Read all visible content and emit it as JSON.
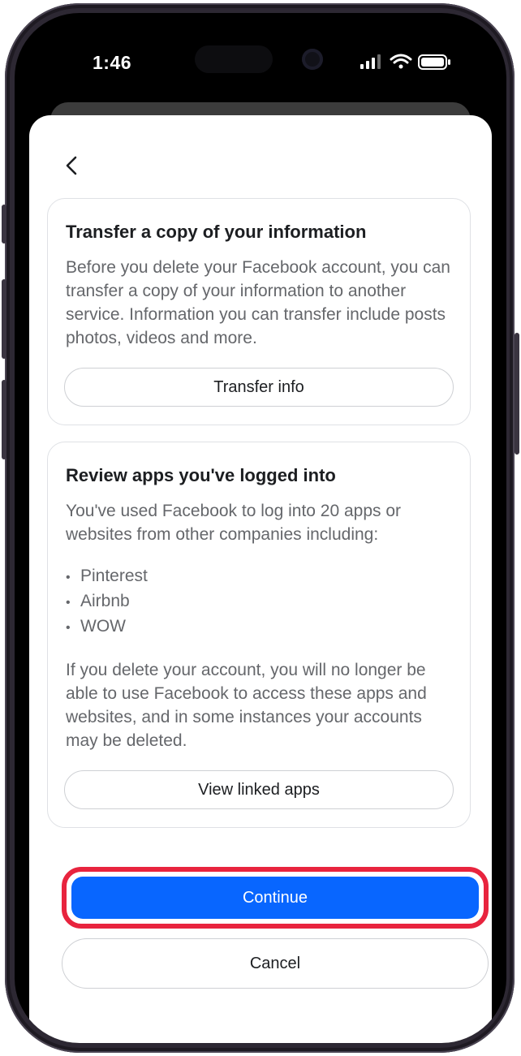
{
  "status_bar": {
    "time": "1:46"
  },
  "transfer_card": {
    "title": "Transfer a copy of your information",
    "body": "Before you delete your Facebook account, you can transfer a copy of your information to another service. Information you can transfer include posts photos, videos and more.",
    "button_label": "Transfer info"
  },
  "apps_card": {
    "title": "Review apps you've logged into",
    "intro": "You've used Facebook to log into 20 apps or websites from other companies including:",
    "apps": [
      "Pinterest",
      "Airbnb",
      "WOW"
    ],
    "warning": "If you delete your account, you will no longer be able to use Facebook to access these apps and websites, and in some instances your accounts may be deleted.",
    "button_label": "View linked apps"
  },
  "actions": {
    "continue_label": "Continue",
    "cancel_label": "Cancel"
  },
  "colors": {
    "primary": "#0866ff",
    "highlight": "#e8243e"
  }
}
